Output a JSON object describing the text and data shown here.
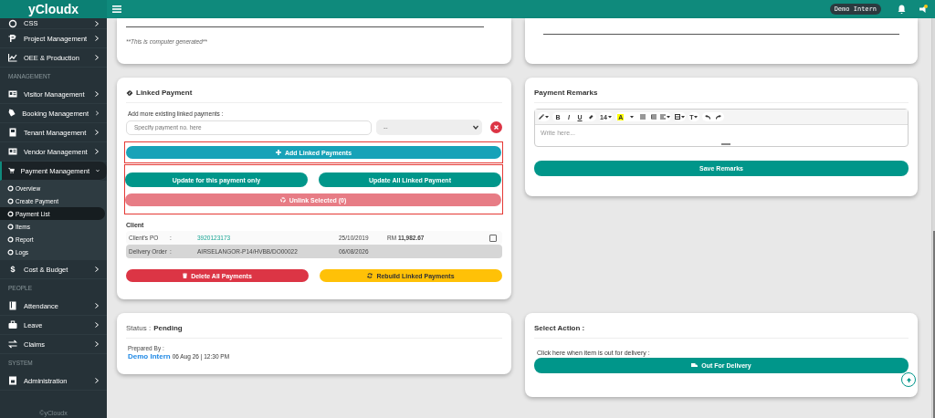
{
  "header": {
    "brand": "yCloudx",
    "user_badge": "Demo Intern"
  },
  "sidebar": {
    "items": [
      {
        "kind": "item",
        "label": "CSS",
        "expanded": false
      },
      {
        "kind": "item",
        "label": "Project Management",
        "expanded": false
      },
      {
        "kind": "item",
        "label": "OEE & Production",
        "expanded": false
      },
      {
        "kind": "heading",
        "label": "MANAGEMENT"
      },
      {
        "kind": "item",
        "label": "Visitor Management",
        "expanded": false
      },
      {
        "kind": "item",
        "label": "Booking Management",
        "expanded": false
      },
      {
        "kind": "item",
        "label": "Tenant Management",
        "expanded": false
      },
      {
        "kind": "item",
        "label": "Vendor Management",
        "expanded": false
      },
      {
        "kind": "item",
        "label": "Payment Management",
        "expanded": true,
        "children": [
          {
            "label": "Overview",
            "selected": false
          },
          {
            "label": "Create Payment",
            "selected": false
          },
          {
            "label": "Payment List",
            "selected": true
          },
          {
            "label": "Items",
            "selected": false
          },
          {
            "label": "Report",
            "selected": false
          },
          {
            "label": "Logs",
            "selected": false
          }
        ]
      },
      {
        "kind": "item",
        "label": "Cost & Budget",
        "glyph": "$",
        "expanded": false
      },
      {
        "kind": "heading",
        "label": "PEOPLE"
      },
      {
        "kind": "item",
        "label": "Attendance",
        "expanded": false
      },
      {
        "kind": "item",
        "label": "Leave",
        "expanded": false
      },
      {
        "kind": "item",
        "label": "Claims",
        "expanded": false
      },
      {
        "kind": "heading",
        "label": "SYSTEM"
      },
      {
        "kind": "item",
        "label": "Administration",
        "expanded": false
      }
    ],
    "footer": "©yCloudx"
  },
  "top_cards": {
    "note": "**This is computer generated**"
  },
  "linked_payment": {
    "title": "Linked Payment",
    "add_label": "Add more existing linked payments :",
    "payment_placeholder": "Specify payment no. here",
    "select_value": "--",
    "add_button": "Add Linked Payments",
    "update_this_button": "Update for this payment only",
    "update_all_button": "Update All Linked Payment",
    "unlink_button": {
      "label": "Unlink Selected (0)",
      "disabled": true
    },
    "client_heading": "Client",
    "client_rows": [
      {
        "label": "Client's PO",
        "colon": ":",
        "value": "3920123173",
        "kind": "link",
        "date": "25/10/2019",
        "currency": "RM",
        "amount": "11,982.67",
        "checked": false,
        "highlighted": false
      },
      {
        "label": "Delivery Order",
        "colon": ":",
        "value": "AIRSELANGOR-P14/HVBB/DO00022",
        "kind": "plain",
        "date": "06/08/2026",
        "highlighted": true
      }
    ],
    "delete_button": "Delete All Payments",
    "rebuild_button": "Rebuild Linked Payments"
  },
  "payment_remarks": {
    "title": "Payment Remarks",
    "toolbar": {
      "bold": "B",
      "italic": "I",
      "underline": "U",
      "font_size": "14",
      "highlight": "A",
      "style": "T"
    },
    "placeholder": "Write here...",
    "save_button": "Save Remarks"
  },
  "status": {
    "label": "Status :",
    "value": "Pending",
    "prepared_label": "Prepared By :",
    "prepared_name": "Demo Intern",
    "prepared_time": "06 Aug 26 | 12:30 PM"
  },
  "select_action": {
    "title": "Select Action :",
    "hint": "Click here when item is out for delivery :",
    "button": "Out For Delivery"
  }
}
